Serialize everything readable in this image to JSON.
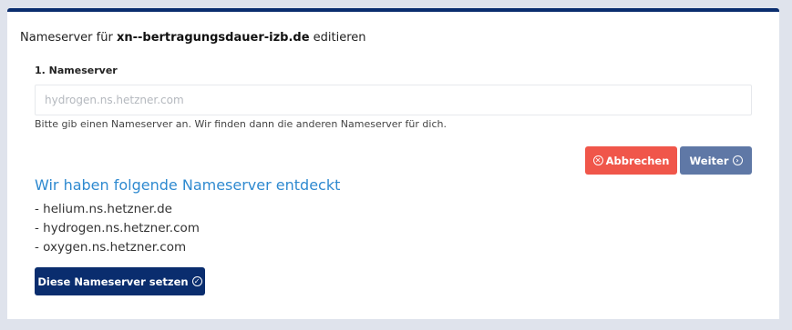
{
  "header": {
    "title_prefix": "Nameserver für",
    "domain": "xn--bertragungsdauer-izb.de",
    "title_suffix": "editieren"
  },
  "form": {
    "field_label": "1. Nameserver",
    "input_value": "",
    "input_placeholder": "hydrogen.ns.hetzner.com",
    "help_text": "Bitte gib einen Nameserver an. Wir finden dann die anderen Nameserver für dich."
  },
  "buttons": {
    "cancel_label": "Abbrechen",
    "cancel_icon": "x-circle-icon",
    "next_label": "Weiter",
    "next_icon": "chevron-right-circle-icon"
  },
  "discovered": {
    "heading": "Wir haben folgende Nameserver entdeckt",
    "items": [
      "- helium.ns.hetzner.de",
      "- hydrogen.ns.hetzner.com",
      "- oxygen.ns.hetzner.com"
    ],
    "set_button_label": "Diese Nameserver setzen",
    "set_button_icon": "check-circle-icon"
  },
  "colors": {
    "accent_navy": "#0a2d6e",
    "cancel_red": "#f0564a",
    "next_blue": "#5f78a6",
    "heading_blue": "#2f8ad0",
    "background": "#dfe3ec"
  }
}
